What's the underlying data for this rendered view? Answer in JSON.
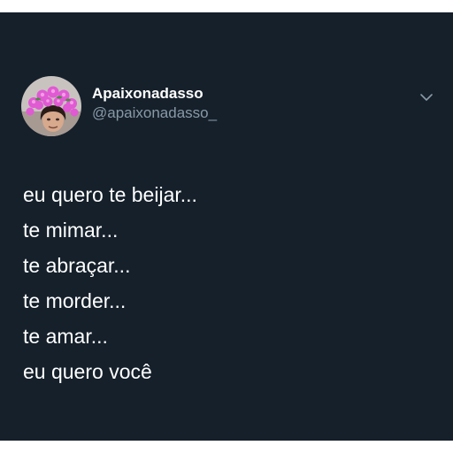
{
  "user": {
    "display_name": "Apaixonadasso",
    "handle": "@apaixonadasso_",
    "avatar_icon": "profile-photo-flower-crown"
  },
  "menu": {
    "icon": "chevron-down-icon"
  },
  "tweet": {
    "lines": [
      "eu quero te beijar...",
      "te mimar...",
      "te abraçar...",
      "te morder...",
      "te amar...",
      "eu quero você"
    ]
  },
  "colors": {
    "background": "#15202b",
    "text": "#ffffff",
    "secondary_text": "#8899a6",
    "accent_flowers": "#e05ad3"
  }
}
